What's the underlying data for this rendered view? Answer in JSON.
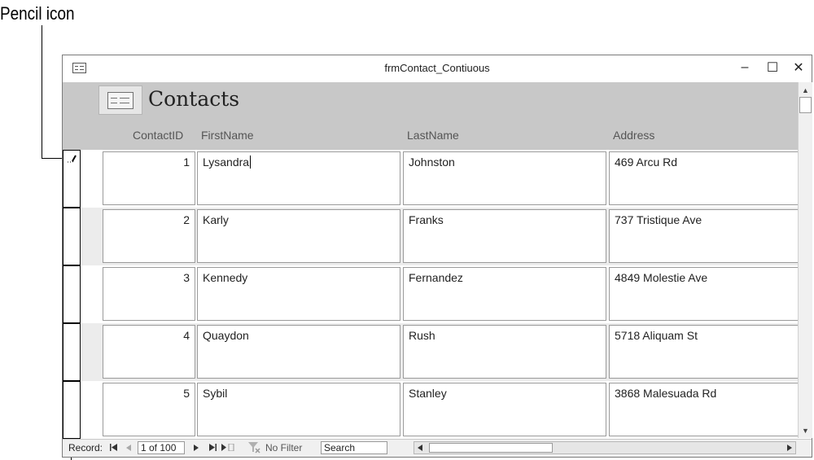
{
  "callouts": {
    "pencil_label": "Pencil icon"
  },
  "window": {
    "title": "frmContact_Contiuous",
    "controls": {
      "minimize": "–",
      "maximize": "☐",
      "close": "✕"
    }
  },
  "form": {
    "title": "Contacts",
    "columns": {
      "id": "ContactID",
      "first": "FirstName",
      "last": "LastName",
      "address": "Address"
    }
  },
  "records": [
    {
      "id": "1",
      "first": "Lysandra",
      "last": "Johnston",
      "address": "469 Arcu Rd"
    },
    {
      "id": "2",
      "first": "Karly",
      "last": "Franks",
      "address": "737 Tristique Ave"
    },
    {
      "id": "3",
      "first": "Kennedy",
      "last": "Fernandez",
      "address": "4849 Molestie Ave"
    },
    {
      "id": "4",
      "first": "Quaydon",
      "last": "Rush",
      "address": "5718 Aliquam St"
    },
    {
      "id": "5",
      "first": "Sybil",
      "last": "Stanley",
      "address": "3868 Malesuada Rd"
    }
  ],
  "navigation": {
    "record_label": "Record:",
    "first_icon": "first-record-icon",
    "prev_icon": "previous-record-icon",
    "next_icon": "next-record-icon",
    "last_icon": "last-record-icon",
    "new_icon": "new-record-icon",
    "position": "1 of 100",
    "filter_icon": "no-filter-icon",
    "filter": "No Filter",
    "search": "Search"
  }
}
